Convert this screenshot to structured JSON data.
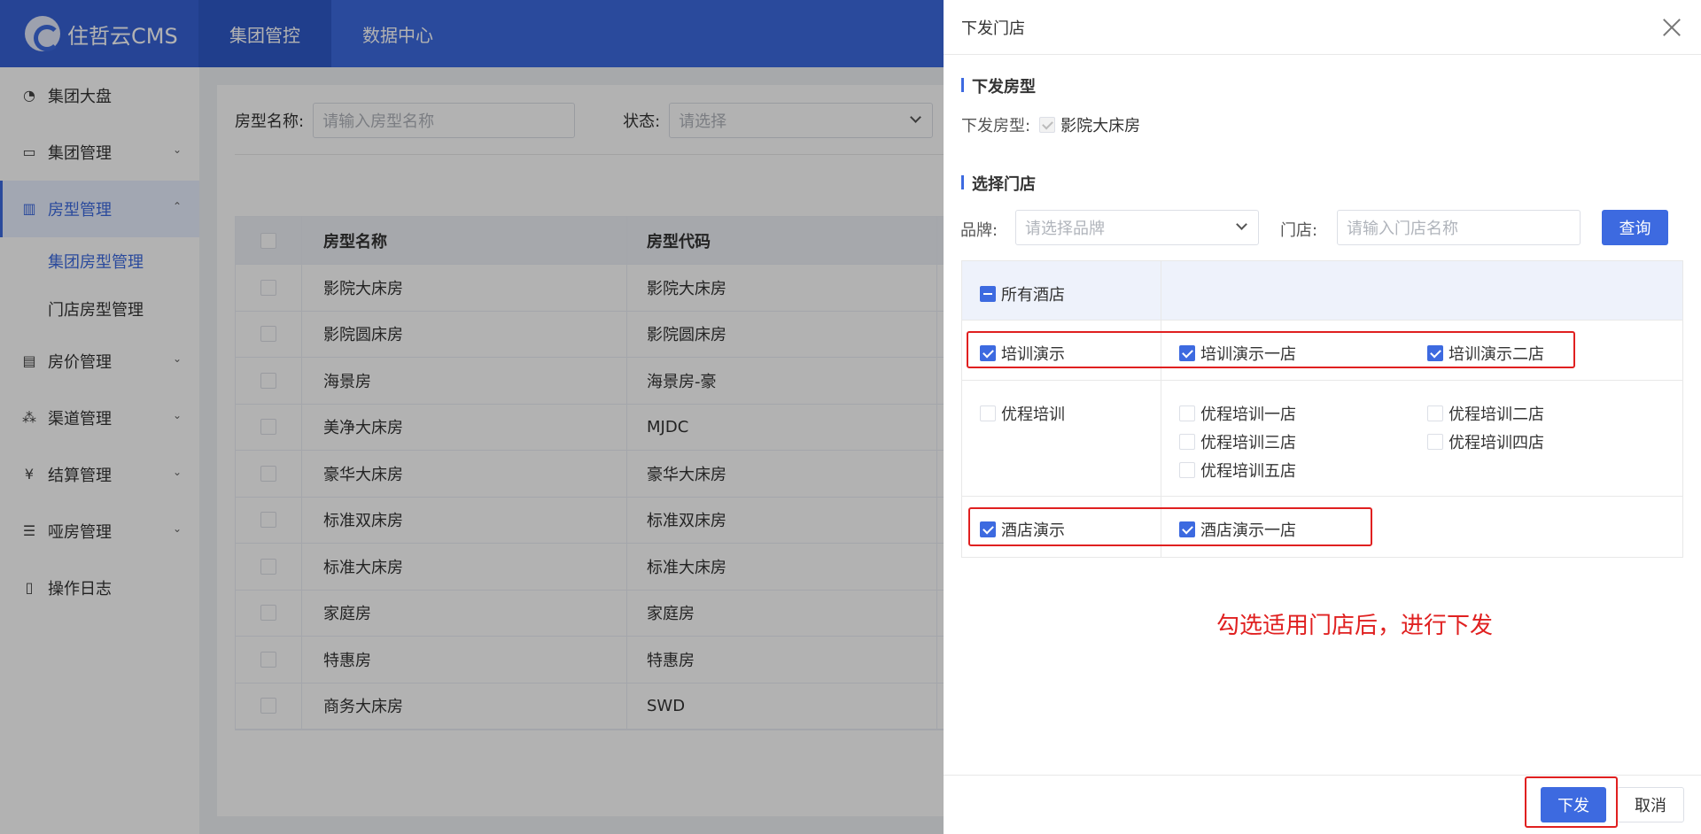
{
  "app": {
    "logo_text": "住哲云CMS"
  },
  "top_nav": [
    {
      "label": "集团管控"
    },
    {
      "label": "数据中心"
    }
  ],
  "sidebar": {
    "items": [
      {
        "label": "集团大盘",
        "icon": "pie-chart-icon"
      },
      {
        "label": "集团管理",
        "icon": "monitor-icon"
      },
      {
        "label": "房型管理",
        "icon": "building-icon"
      },
      {
        "label": "房价管理",
        "icon": "wallet-icon"
      },
      {
        "label": "渠道管理",
        "icon": "share-icon"
      },
      {
        "label": "结算管理",
        "icon": "yen-icon"
      },
      {
        "label": "哑房管理",
        "icon": "list-icon"
      },
      {
        "label": "操作日志",
        "icon": "document-icon"
      }
    ],
    "sub_items": [
      {
        "label": "集团房型管理"
      },
      {
        "label": "门店房型管理"
      }
    ]
  },
  "filter": {
    "room_name_label": "房型名称:",
    "room_name_placeholder": "请输入房型名称",
    "status_label": "状态:",
    "status_placeholder": "请选择"
  },
  "table": {
    "headers": [
      "房型名称",
      "房型代码"
    ],
    "rows": [
      [
        "影院大床房",
        "影院大床房"
      ],
      [
        "影院圆床房",
        "影院圆床房"
      ],
      [
        "海景房",
        "海景房-豪"
      ],
      [
        "美净大床房",
        "MJDC"
      ],
      [
        "豪华大床房",
        "豪华大床房"
      ],
      [
        "标准双床房",
        "标准双床房"
      ],
      [
        "标准大床房",
        "标准大床房"
      ],
      [
        "家庭房",
        "家庭房"
      ],
      [
        "特惠房",
        "特惠房"
      ],
      [
        "商务大床房",
        "SWD"
      ]
    ]
  },
  "drawer": {
    "title": "下发门店",
    "section1_title": "下发房型",
    "room_type_label": "下发房型:",
    "room_type_value": "影院大床房",
    "section2_title": "选择门店",
    "brand_label": "品牌:",
    "brand_placeholder": "请选择品牌",
    "store_label": "门店:",
    "store_placeholder": "请输入门店名称",
    "query_button": "查询",
    "all_hotels": "所有酒店",
    "groups": [
      {
        "name": "培训演示",
        "checked": true,
        "stores": [
          "培训演示一店",
          "培训演示二店"
        ]
      },
      {
        "name": "优程培训",
        "checked": false,
        "stores": [
          "优程培训一店",
          "优程培训二店",
          "优程培训三店",
          "优程培训四店",
          "优程培训五店"
        ]
      },
      {
        "name": "酒店演示",
        "checked": true,
        "stores": [
          "酒店演示一店"
        ]
      }
    ],
    "annotation": "勾选适用门店后，进行下发",
    "submit_button": "下发",
    "cancel_button": "取消"
  },
  "colors": {
    "primary": "#3d6ae0",
    "annotation_red": "#e02020"
  }
}
